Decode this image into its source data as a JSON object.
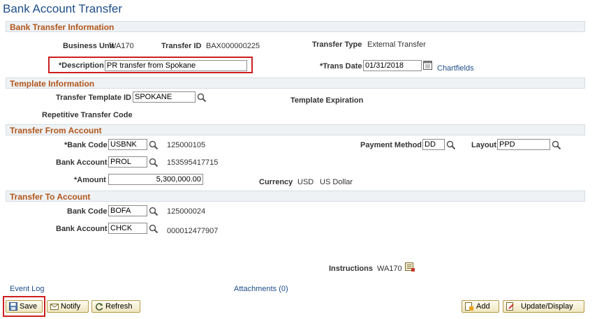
{
  "page": {
    "title": "Bank Account Transfer"
  },
  "bank_transfer_info": {
    "header": "Bank Transfer Information",
    "business_unit_label": "Business Unit",
    "business_unit_value": "WA170",
    "transfer_id_label": "Transfer ID",
    "transfer_id_value": "BAX000000225",
    "transfer_type_label": "Transfer Type",
    "transfer_type_value": "External Transfer",
    "description_label": "*Description",
    "description_value": "PR transfer from Spokane",
    "trans_date_label": "*Trans Date",
    "trans_date_value": "01/31/2018",
    "chartfields_link": "Chartfields"
  },
  "template_info": {
    "header": "Template Information",
    "transfer_template_id_label": "Transfer Template ID",
    "transfer_template_id_value": "SPOKANE",
    "template_expiration_label": "Template Expiration",
    "repetitive_transfer_code_label": "Repetitive Transfer Code"
  },
  "transfer_from": {
    "header": "Transfer From Account",
    "bank_code_label": "*Bank Code",
    "bank_code_value": "USBNK",
    "bank_code_desc": "125000105",
    "payment_method_label": "Payment Method",
    "payment_method_value": "DD",
    "layout_label": "Layout",
    "layout_value": "PPD",
    "bank_account_label": "Bank Account",
    "bank_account_value": "PROL",
    "bank_account_desc": "153595417715",
    "amount_label": "*Amount",
    "amount_value": "5,300,000.00",
    "currency_label": "Currency",
    "currency_code": "USD",
    "currency_desc": "US Dollar"
  },
  "transfer_to": {
    "header": "Transfer To Account",
    "bank_code_label": "Bank Code",
    "bank_code_value": "BOFA",
    "bank_code_desc": "125000024",
    "bank_account_label": "Bank Account",
    "bank_account_value": "CHCK",
    "bank_account_desc": "000012477907"
  },
  "instructions": {
    "label": "Instructions",
    "value": "WA170"
  },
  "links": {
    "event_log": "Event Log",
    "attachments": "Attachments (0)"
  },
  "toolbar": {
    "save": "Save",
    "notify": "Notify",
    "refresh": "Refresh",
    "add": "Add",
    "update_display": "Update/Display"
  },
  "colors": {
    "section_header_text": "#b2561a",
    "title_text": "#1f4e8a",
    "highlight_border": "#cc1f1f"
  }
}
